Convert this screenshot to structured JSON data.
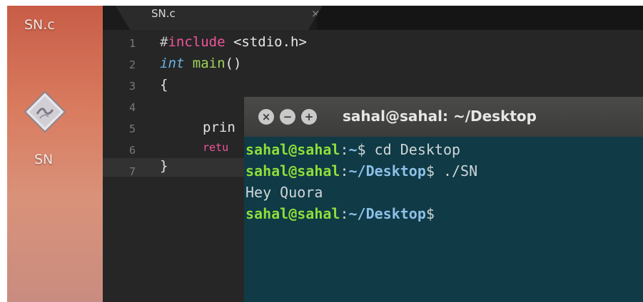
{
  "desktop": {
    "file_icon_label": "SN.c",
    "executable_icon_label": "SN"
  },
  "editor": {
    "tab": {
      "title": "SN.c",
      "close_glyph": "×"
    },
    "line_numbers": [
      "1",
      "2",
      "3",
      "4",
      "5",
      "6",
      "7"
    ],
    "code": {
      "line1_hash": "#",
      "line1_keyword": "include",
      "line1_header": " <stdio.h>",
      "line2_type": "int",
      "line2_fn": " main",
      "line2_parens": "()",
      "line3": "{",
      "line5_fragment": "prin",
      "line6_fragment": "retu",
      "line7": "}"
    }
  },
  "terminal": {
    "title": "sahal@sahal: ~/Desktop",
    "buttons": {
      "close": "×",
      "minimize": "−",
      "maximize": "+"
    },
    "lines": [
      {
        "user": "sahal@sahal",
        "sep": ":",
        "path": "~",
        "prompt": "$ cd Desktop"
      },
      {
        "user": "sahal@sahal",
        "sep": ":",
        "path": "~/Desktop",
        "prompt": "$ ./SN"
      },
      {
        "output": "Hey Quora"
      },
      {
        "user": "sahal@sahal",
        "sep": ":",
        "path": "~/Desktop",
        "prompt": "$"
      }
    ]
  },
  "colors": {
    "desktop_gradient_top": "#c85d47",
    "editor_bg": "#262626",
    "terminal_bg": "#0f3a46",
    "prompt_user": "#8fdd3a",
    "prompt_path": "#8ebfe6",
    "keyword_pink": "#f0559c",
    "function_green": "#9ed35a",
    "type_blue": "#6ab3e8"
  }
}
